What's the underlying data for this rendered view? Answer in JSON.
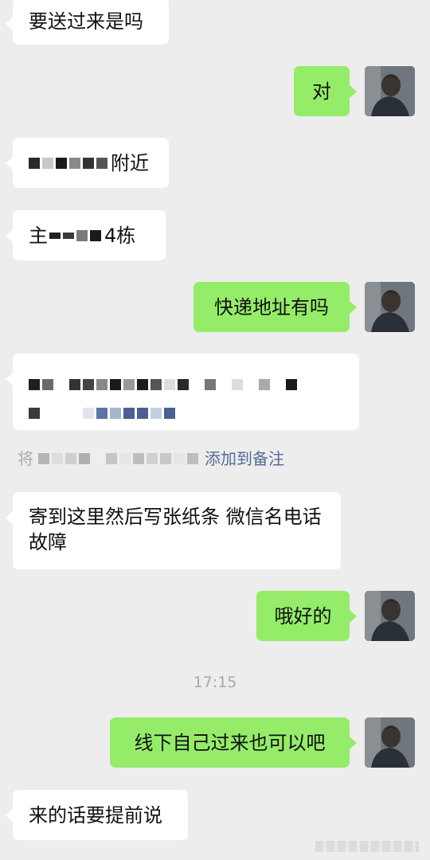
{
  "messages": {
    "m1": "要送过来是吗",
    "m2": "对",
    "m3_suffix": "附近",
    "m4_prefix": "主",
    "m4_suffix": "4栋",
    "m5": "快递地址有吗",
    "m7": "寄到这里然后写张纸条 微信名电话 故障",
    "m8": "哦好的",
    "m9": "线下自己过来也可以吧",
    "m10": "来的话要提前说"
  },
  "address_hint": {
    "prefix": "将",
    "link": "添加到备注"
  },
  "timestamp": "17:15",
  "colors": {
    "background": "#ededed",
    "incoming": "#ffffff",
    "outgoing": "#95ec69",
    "link": "#576b95"
  }
}
